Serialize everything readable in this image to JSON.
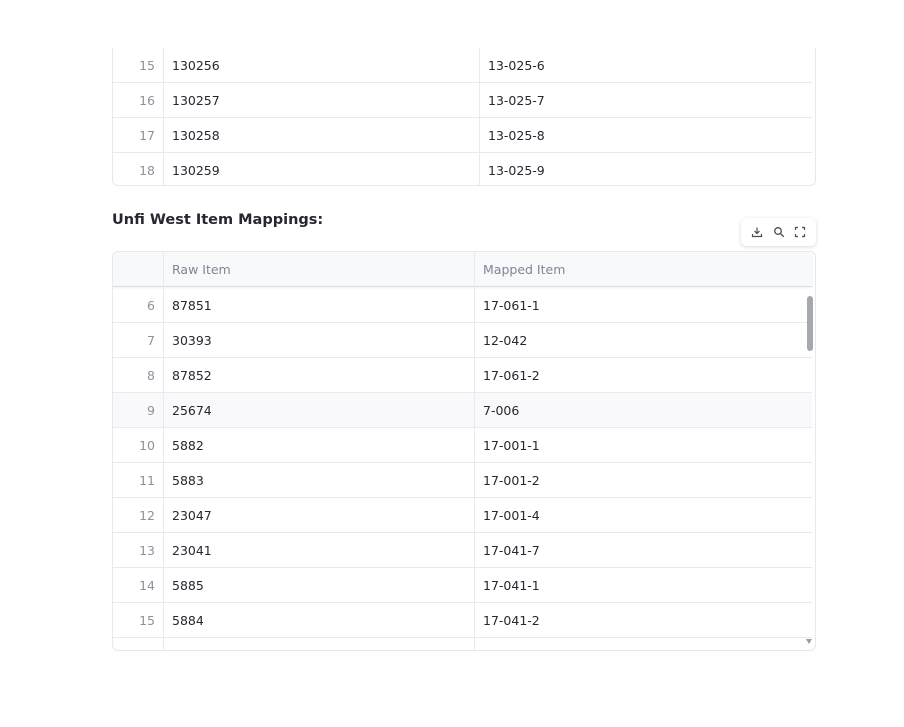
{
  "top_table": {
    "rows": [
      {
        "index": "15",
        "raw": "130256",
        "mapped": "13-025-6"
      },
      {
        "index": "16",
        "raw": "130257",
        "mapped": "13-025-7"
      },
      {
        "index": "17",
        "raw": "130258",
        "mapped": "13-025-8"
      },
      {
        "index": "18",
        "raw": "130259",
        "mapped": "13-025-9"
      }
    ]
  },
  "section_title": "Unfi West Item Mappings:",
  "toolbar": {
    "download_icon": "download-icon",
    "search_icon": "search-icon",
    "fullscreen_icon": "fullscreen-icon"
  },
  "bottom_table": {
    "columns": [
      "",
      "Raw Item",
      "Mapped Item"
    ],
    "rows": [
      {
        "index": "6",
        "raw": "87851",
        "mapped": "17-061-1"
      },
      {
        "index": "7",
        "raw": "30393",
        "mapped": "12-042"
      },
      {
        "index": "8",
        "raw": "87852",
        "mapped": "17-061-2"
      },
      {
        "index": "9",
        "raw": "25674",
        "mapped": "7-006"
      },
      {
        "index": "10",
        "raw": "5882",
        "mapped": "17-001-1"
      },
      {
        "index": "11",
        "raw": "5883",
        "mapped": "17-001-2"
      },
      {
        "index": "12",
        "raw": "23047",
        "mapped": "17-001-4"
      },
      {
        "index": "13",
        "raw": "23041",
        "mapped": "17-041-7"
      },
      {
        "index": "14",
        "raw": "5885",
        "mapped": "17-041-1"
      },
      {
        "index": "15",
        "raw": "5884",
        "mapped": "17-041-2"
      }
    ]
  }
}
